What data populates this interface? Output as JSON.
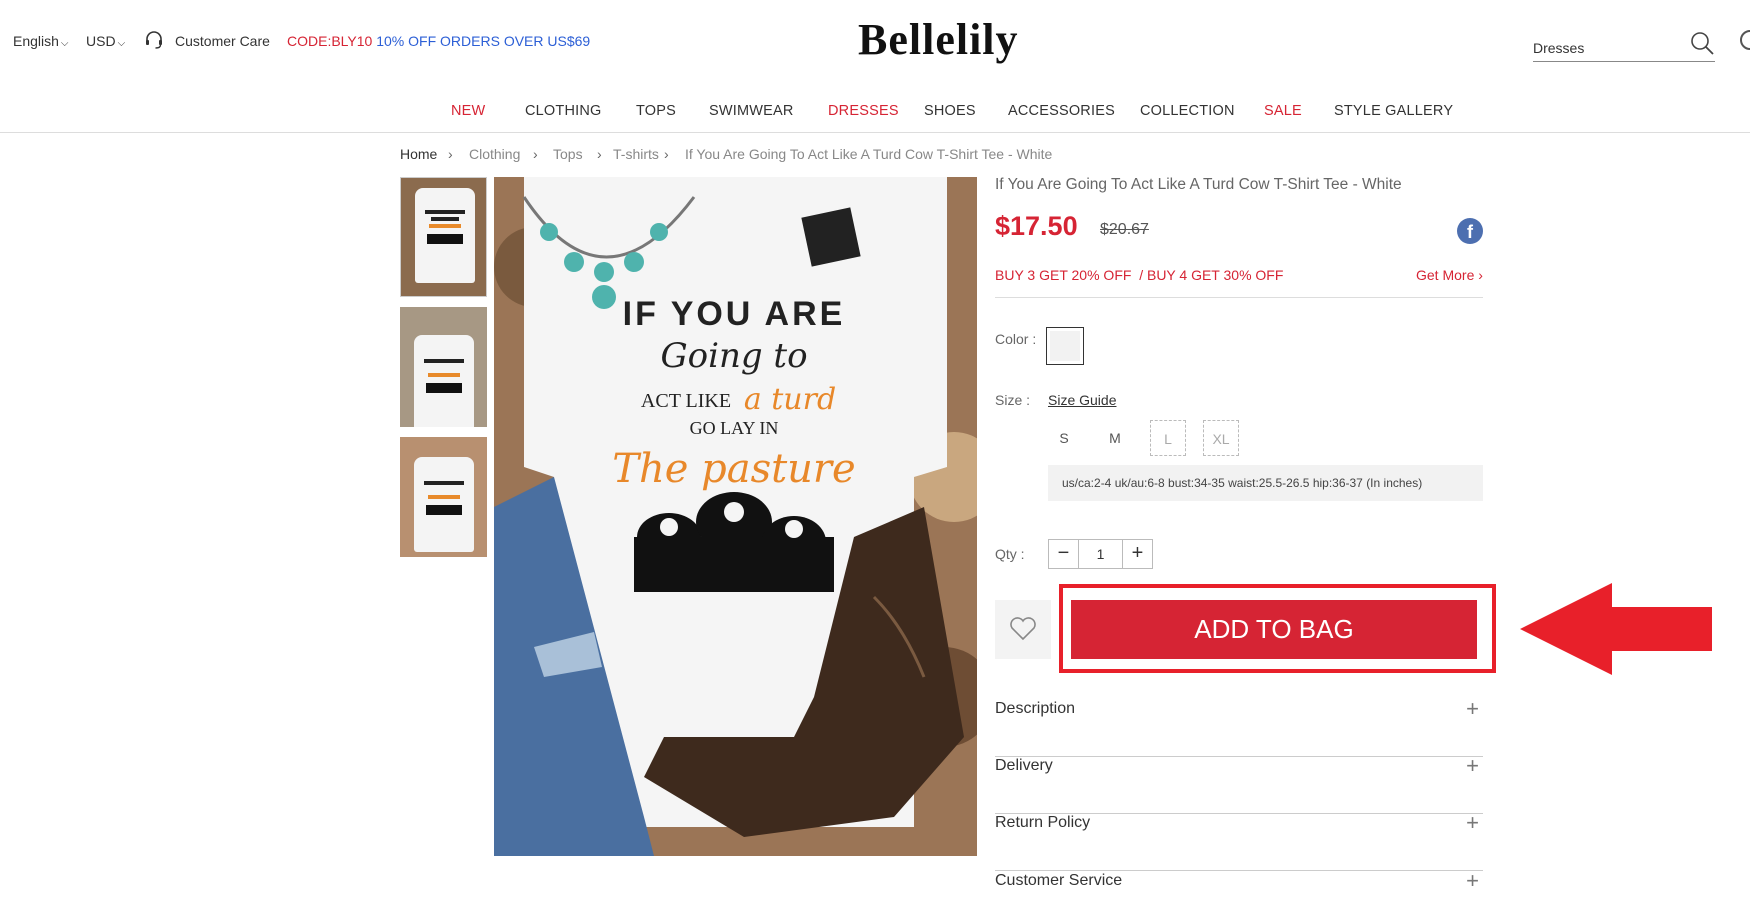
{
  "header": {
    "language": "English",
    "currency": "USD",
    "customer_care": "Customer Care",
    "promo_code": "CODE:BLY10",
    "promo_text": "10% OFF ORDERS OVER US$69",
    "logo": "Bellelily",
    "search_value": "Dresses"
  },
  "nav": {
    "items": [
      "NEW",
      "CLOTHING",
      "TOPS",
      "SWIMWEAR",
      "DRESSES",
      "SHOES",
      "ACCESSORIES",
      "COLLECTION",
      "SALE",
      "STYLE GALLERY"
    ]
  },
  "breadcrumb": {
    "items": [
      "Home",
      "Clothing",
      "Tops",
      "T-shirts",
      "If You Are Going To Act Like A Turd Cow T-Shirt Tee - White"
    ]
  },
  "product": {
    "title": "If You Are Going To Act Like A Turd Cow T-Shirt Tee - White",
    "price": "$17.50",
    "old_price": "$20.67",
    "offer": "BUY 3 GET 20% OFF  / BUY 4 GET 30% OFF",
    "get_more": "Get More",
    "color_label": "Color :",
    "size_label": "Size :",
    "size_guide": "Size Guide",
    "sizes": [
      "S",
      "M",
      "L",
      "XL"
    ],
    "size_info": "us/ca:2-4 uk/au:6-8 bust:34-35 waist:25.5-26.5 hip:36-37 (In inches)",
    "qty_label": "Qty :",
    "qty_value": "1",
    "add_to_bag": "ADD TO BAG",
    "accordion": [
      "Description",
      "Delivery",
      "Return Policy",
      "Customer Service"
    ]
  },
  "shirt_print": {
    "line1": "IF YOU ARE",
    "line2": "Going to",
    "line3a": "ACT LIKE ",
    "line3b": "a turd",
    "line4": "GO LAY IN",
    "line5": "The pasture"
  },
  "colors": {
    "accent_red": "#d62434",
    "promo_blue": "#2c5fd6",
    "annotation_red": "#e8202a"
  }
}
